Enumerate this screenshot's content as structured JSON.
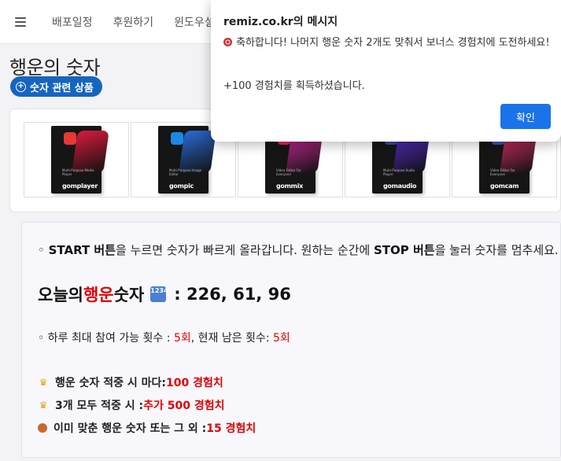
{
  "nav": {
    "items": [
      "배포일정",
      "후원하기",
      "윈도우설"
    ]
  },
  "page": {
    "title": "행운의 숫자",
    "products_button": "숫자 관련 상품"
  },
  "products": [
    {
      "brand": "gomplayer",
      "blurb": "Multi-Purpose Media Player",
      "art_color": "#d81b3c",
      "logo_color": "#e53935"
    },
    {
      "brand": "gompic",
      "blurb": "Multi-Purpose Image Editor",
      "art_color": "#2a6bd6",
      "logo_color": "#1e88e5"
    },
    {
      "brand": "gommix",
      "blurb": "Video Editor For Everyone",
      "art_color": "#d52aa0",
      "logo_color": "#e91e63"
    },
    {
      "brand": "gomaudio",
      "blurb": "Multi-Purpose Audio Player",
      "art_color": "#5a2dd0",
      "logo_color": "#3949ab"
    },
    {
      "brand": "gomcam",
      "blurb": "Video Editor For Everyone",
      "art_color": "#e0306a",
      "logo_color": "#3f51b5"
    }
  ],
  "info": {
    "start_prefix": "◦ ",
    "start_bold": "START 버튼",
    "start_mid": "을 누르면 숫자가 빠르게 올라갑니다. 원하는 순간에 ",
    "stop_bold": "STOP 버튼",
    "start_suffix": "을 눌러 숫자를 멈추세요.",
    "lucky_prefix": "오늘의 ",
    "lucky_red": "행운",
    "lucky_suffix": " 숫자",
    "lucky_icon_text": "1234",
    "lucky_numbers": ": 226, 61, 96",
    "attempts_prefix": "◦ 하루 최대 참여 가능 횟수 : ",
    "attempts_max": "5회",
    "attempts_mid": ", 현재 남은 횟수: ",
    "attempts_left": "5회",
    "rewards": [
      {
        "icon": "crown-icon",
        "label": "행운 숫자 적중 시 마다: ",
        "value": "100 경험치"
      },
      {
        "icon": "crown-icon",
        "label": "3개 모두 적중 시 : ",
        "value": "추가 500 경험치"
      },
      {
        "icon": "medal-icon",
        "label": "이미 맞춘 행운 숫자 또는 그 외 : ",
        "value": "15 경험치"
      }
    ]
  },
  "dialog": {
    "title": "remiz.co.kr의 메시지",
    "message": "축하합니다! 나머지 행운 숫자 2개도 맞춰서 보너스 경험치에 도전하세요!",
    "sub": "+100 경험치를 획득하셨습니다.",
    "ok_label": "확인"
  },
  "colors": {
    "accent": "#1565c0",
    "highlight": "#e00000",
    "dialog_button": "#1a73e8"
  }
}
